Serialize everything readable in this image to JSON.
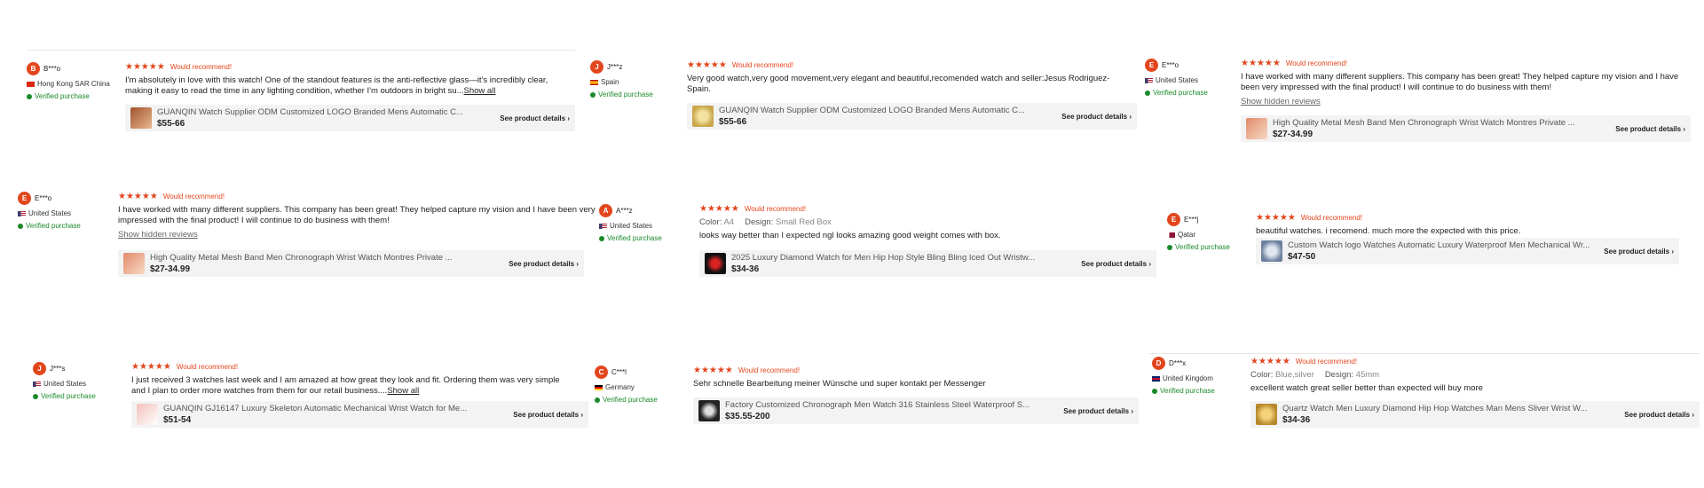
{
  "labels": {
    "would_recommend": "Would recommend!",
    "verified": "Verified purchase",
    "see_details": "See product details",
    "show_all": "Show all",
    "show_hidden": "Show hidden reviews",
    "stars": "★★★★★",
    "color_label": "Color:",
    "design_label": "Design:"
  },
  "colors": {
    "accent": "#e2461d",
    "verified": "#1a8a2a"
  },
  "reviews": [
    {
      "initial": "B",
      "name": "B***o",
      "country": "Hong Kong SAR China",
      "text": "I'm absolutely in love with this watch!  One of the standout features is the anti-reflective glass—it's incredibly clear, making it easy to read the time in any lighting condition, whether I'm outdoors in bright su...",
      "product_title": "GUANQIN Watch Supplier ODM Customized LOGO Branded Mens Automatic C...",
      "price": "$55-66"
    },
    {
      "initial": "J",
      "name": "J***z",
      "country": "Spain",
      "text": "Very good watch,very good movement,very elegant and beautiful,recomended watch and seller:Jesus Rodriguez-Spain.",
      "product_title": "GUANQIN Watch Supplier ODM Customized LOGO Branded Mens Automatic C...",
      "price": "$55-66"
    },
    {
      "initial": "E",
      "name": "E***o",
      "country": "United States",
      "text": "I have worked with many different suppliers. This company has been great! They helped capture my vision and I have been very impressed with the final product! I will continue to do business with them!",
      "product_title": "High Quality Metal Mesh Band Men Chronograph Wrist Watch Montres Private ...",
      "price": "$27-34.99"
    },
    {
      "initial": "E",
      "name": "E***o",
      "country": "United States",
      "text": "I have worked with many different suppliers. This company has been great! They helped capture my vision and I have been very impressed with the final product! I will continue to do business with them!",
      "product_title": "High Quality Metal Mesh Band Men Chronograph Wrist Watch Montres Private ...",
      "price": "$27-34.99"
    },
    {
      "initial": "A",
      "name": "A***z",
      "country": "United States",
      "color": "A4",
      "design": "Small Red Box",
      "text": "looks way better than I expected ngl looks amazing good weight comes with box.",
      "product_title": "2025 Luxury Diamond Watch for Men Hip Hop Style Bling Bling Iced Out Wristw...",
      "price": "$34-36"
    },
    {
      "initial": "E",
      "name": "E***j",
      "country": "Qatar",
      "text": "beautiful watches. i recomend. much more the expected with this price.",
      "product_title": "Custom Watch logo Watches Automatic Luxury Waterproof Men Mechanical Wr...",
      "price": "$47-50"
    },
    {
      "initial": "J",
      "name": "J***s",
      "country": "United States",
      "text": "I just received 3 watches last week and I am amazed at how great they look and fit. Ordering them was very simple and I plan to order more watches from them for our retail business....",
      "product_title": "GUANQIN GJ16147 Luxury Skeleton Automatic Mechanical Wrist Watch for Me...",
      "price": "$51-54"
    },
    {
      "initial": "C",
      "name": "C***l",
      "country": "Germany",
      "text": "Sehr schnelle Bearbeitung meiner Wünsche und super kontakt per Messenger",
      "product_title": "Factory Customized Chronograph Men Watch 316 Stainless Steel Waterproof S...",
      "price": "$35.55-200"
    },
    {
      "initial": "D",
      "name": "D***x",
      "country": "United Kingdom",
      "color": "Blue,silver",
      "design": "45mm",
      "text": "excellent watch great seller better than expected will buy more",
      "product_title": "Quartz Watch Men Luxury Diamond Hip Hop Watches Man Mens Sliver Wrist W...",
      "price": "$34-36"
    }
  ]
}
